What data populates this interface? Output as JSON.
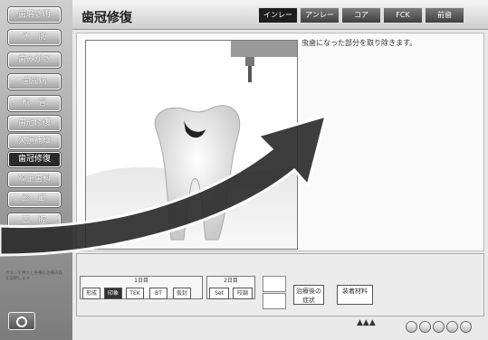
{
  "sidebar": {
    "items": [
      {
        "label": "歯磨き術"
      },
      {
        "label": "予　防"
      },
      {
        "label": "歯みがき"
      },
      {
        "label": "歯周病"
      },
      {
        "label": "根　管"
      },
      {
        "label": "歯冠修復"
      },
      {
        "label": "欠損補綴"
      },
      {
        "label": "歯冠修復"
      },
      {
        "label": "矯正歯科"
      },
      {
        "label": "診　断"
      },
      {
        "label": "口　腔"
      }
    ],
    "active_index": 7,
    "note": "ボタンを押すと各種の治療内容を説明します"
  },
  "header": {
    "title": "歯冠修復",
    "tabs": [
      {
        "label": "インレー"
      },
      {
        "label": "アンレー"
      },
      {
        "label": "コア"
      },
      {
        "label": "FCK"
      },
      {
        "label": "前歯"
      }
    ],
    "selected_tab": 0
  },
  "main": {
    "caption": "虫歯になった部分を取り除きます。"
  },
  "controls": {
    "group1": {
      "label": "1日目",
      "steps": [
        "形成",
        "印象",
        "TEK",
        "BT",
        "仮封"
      ]
    },
    "group2": {
      "label": "2日目",
      "steps": [
        "Set",
        "咬調"
      ]
    },
    "buttons": [
      {
        "label": "治療後の症状"
      },
      {
        "label": "装着材料"
      }
    ]
  },
  "colors": {
    "accent": "#1e1e1e",
    "arrow": "#2d2d2d"
  }
}
